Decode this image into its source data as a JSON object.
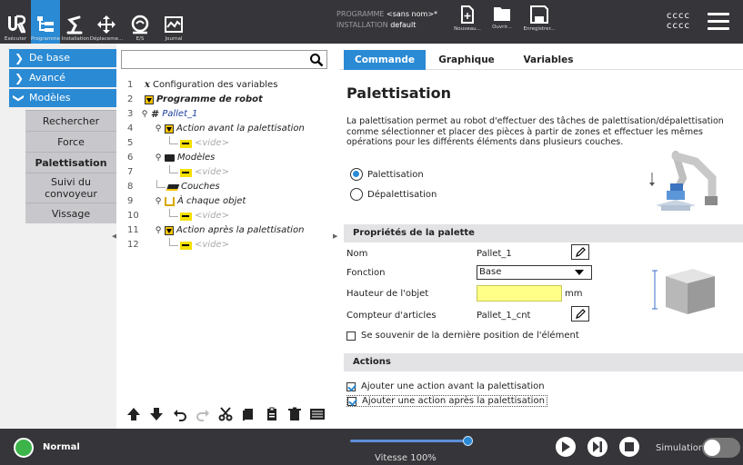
{
  "topbar": {
    "nav": [
      {
        "label": "Exécuter",
        "icon": "ur-logo-icon"
      },
      {
        "label": "Programme",
        "icon": "program-icon"
      },
      {
        "label": "Installation",
        "icon": "robot-arm-icon"
      },
      {
        "label": "Déplaceme...",
        "icon": "move-icon"
      },
      {
        "label": "E/S",
        "icon": "io-icon"
      },
      {
        "label": "Journal",
        "icon": "log-icon"
      }
    ],
    "program_key": "PROGRAMME",
    "program_val": "<sans nom>*",
    "install_key": "INSTALLATION",
    "install_val": "default",
    "file_buttons": [
      {
        "label": "Nouveau...",
        "icon": "new-file-icon"
      },
      {
        "label": "Ouvrir...",
        "icon": "folder-icon"
      },
      {
        "label": "Enregistrer...",
        "icon": "save-icon"
      }
    ],
    "user_line1": "cccc",
    "user_line2": "cccc"
  },
  "left": {
    "categories": [
      "De base",
      "Avancé",
      "Modèles"
    ],
    "items": [
      "Rechercher",
      "Force",
      "Palettisation",
      "Suivi du convoyeur",
      "Vissage"
    ]
  },
  "tree": {
    "search_placeholder": "",
    "rows": [
      {
        "num": "1",
        "text": "Configuration des variables"
      },
      {
        "num": "2",
        "text": "Programme de robot"
      },
      {
        "num": "3",
        "text": "Pallet_1"
      },
      {
        "num": "4",
        "text": "Action avant la palettisation"
      },
      {
        "num": "5",
        "text": "<vide>"
      },
      {
        "num": "6",
        "text": "Modèles"
      },
      {
        "num": "7",
        "text": "<vide>"
      },
      {
        "num": "8",
        "text": "Couches"
      },
      {
        "num": "9",
        "text": "À chaque objet"
      },
      {
        "num": "10",
        "text": "<vide>"
      },
      {
        "num": "11",
        "text": "Action après la palettisation"
      },
      {
        "num": "12",
        "text": "<vide>"
      }
    ]
  },
  "right": {
    "tabs": [
      "Commande",
      "Graphique",
      "Variables"
    ],
    "heading": "Palettisation",
    "description": "La palettisation permet au robot d'effectuer des tâches de palettisation/dépalettisation comme sélectionner et placer des pièces à partir de zones et effectuer les mêmes opérations pour les différents éléments dans plusieurs couches.",
    "radio_pal": "Palettisation",
    "radio_depal": "Dépalettisation",
    "section_props": "Propriétés de la palette",
    "name_label": "Nom",
    "name_value": "Pallet_1",
    "function_label": "Fonction",
    "function_value": "Base",
    "height_label": "Hauteur de l'objet",
    "height_value": "",
    "height_unit": "mm",
    "counter_label": "Compteur d'articles",
    "counter_value": "Pallet_1_cnt",
    "remember_label": "Se souvenir de la dernière position de l'élément",
    "section_actions": "Actions",
    "action_before": "Ajouter une action avant la palettisation",
    "action_after": "Ajouter une action après la palettisation"
  },
  "footer": {
    "status": "Normal",
    "speed": "Vitesse 100%",
    "speed_fraction": 1.0,
    "simulation": "Simulation"
  },
  "colors": {
    "accent": "#2a8ad4",
    "topbar": "#36363a",
    "status_ok": "#3cb44a",
    "input_yellow": "#ffff88"
  }
}
